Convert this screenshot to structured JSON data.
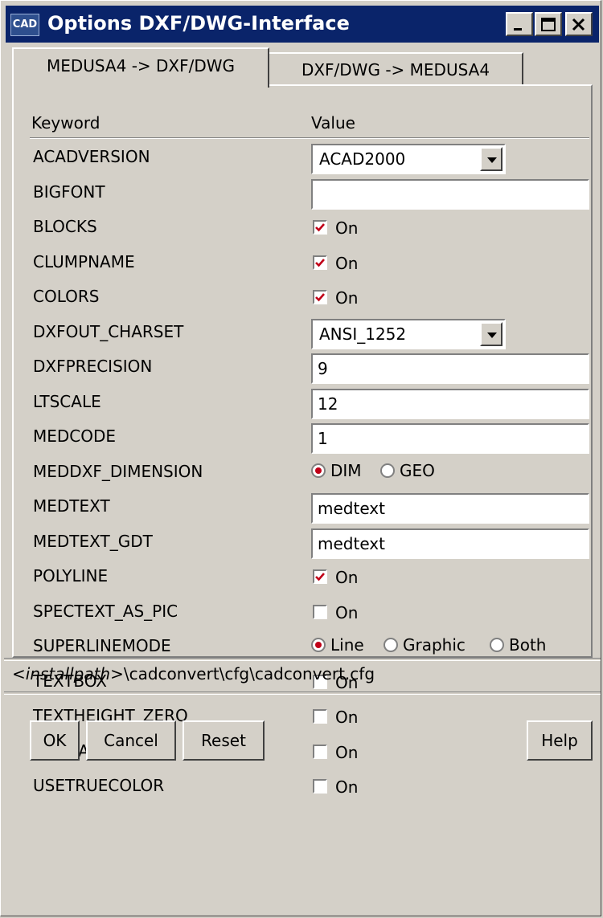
{
  "window": {
    "title": "Options DXF/DWG-Interface",
    "app_icon_text": "CAD",
    "controls": {
      "minimize": "minimize-icon",
      "maximize": "maximize-icon",
      "close": "close-icon"
    }
  },
  "tabs": [
    {
      "label": "MEDUSA4 -> DXF/DWG",
      "active": true
    },
    {
      "label": "DXF/DWG -> MEDUSA4",
      "active": false
    }
  ],
  "table": {
    "headers": {
      "keyword": "Keyword",
      "value": "Value"
    },
    "rows": [
      {
        "keyword": "ACADVERSION",
        "type": "select",
        "value": "ACAD2000"
      },
      {
        "keyword": "BIGFONT",
        "type": "text",
        "value": ""
      },
      {
        "keyword": "BLOCKS",
        "type": "checkbox",
        "checked": true,
        "label": "On"
      },
      {
        "keyword": "CLUMPNAME",
        "type": "checkbox",
        "checked": true,
        "label": "On"
      },
      {
        "keyword": "COLORS",
        "type": "checkbox",
        "checked": true,
        "label": "On"
      },
      {
        "keyword": "DXFOUT_CHARSET",
        "type": "select",
        "value": "ANSI_1252"
      },
      {
        "keyword": "DXFPRECISION",
        "type": "text",
        "value": "9"
      },
      {
        "keyword": "LTSCALE",
        "type": "text",
        "value": "12"
      },
      {
        "keyword": "MEDCODE",
        "type": "text",
        "value": "1"
      },
      {
        "keyword": "MEDDXF_DIMENSION",
        "type": "radio",
        "options": [
          "DIM",
          "GEO"
        ],
        "selected": "DIM"
      },
      {
        "keyword": "MEDTEXT",
        "type": "text",
        "value": "medtext"
      },
      {
        "keyword": "MEDTEXT_GDT",
        "type": "text",
        "value": "medtext"
      },
      {
        "keyword": "POLYLINE",
        "type": "checkbox",
        "checked": true,
        "label": "On"
      },
      {
        "keyword": "SPECTEXT_AS_PIC",
        "type": "checkbox",
        "checked": false,
        "label": "On"
      },
      {
        "keyword": "SUPERLINEMODE",
        "type": "radio",
        "options": [
          "Line",
          "Graphic",
          "Both"
        ],
        "selected": "Line"
      },
      {
        "keyword": "TEXTBOX",
        "type": "checkbox",
        "checked": false,
        "label": "On"
      },
      {
        "keyword": "TEXTHEIGHT_ZERO",
        "type": "checkbox",
        "checked": false,
        "label": "On"
      },
      {
        "keyword": "UNSCALE",
        "type": "checkbox",
        "checked": false,
        "label": "On"
      },
      {
        "keyword": "USETRUECOLOR",
        "type": "checkbox",
        "checked": false,
        "label": "On"
      }
    ]
  },
  "config_path": {
    "prefix": "<installpath>",
    "suffix": "\\cadconvert\\cfg\\cadconvert.cfg"
  },
  "buttons": {
    "ok": "OK",
    "cancel": "Cancel",
    "reset": "Reset",
    "help": "Help"
  },
  "colors": {
    "titlebar": "#0a246a",
    "face": "#d4d0c8",
    "check_mark": "#c00018"
  }
}
